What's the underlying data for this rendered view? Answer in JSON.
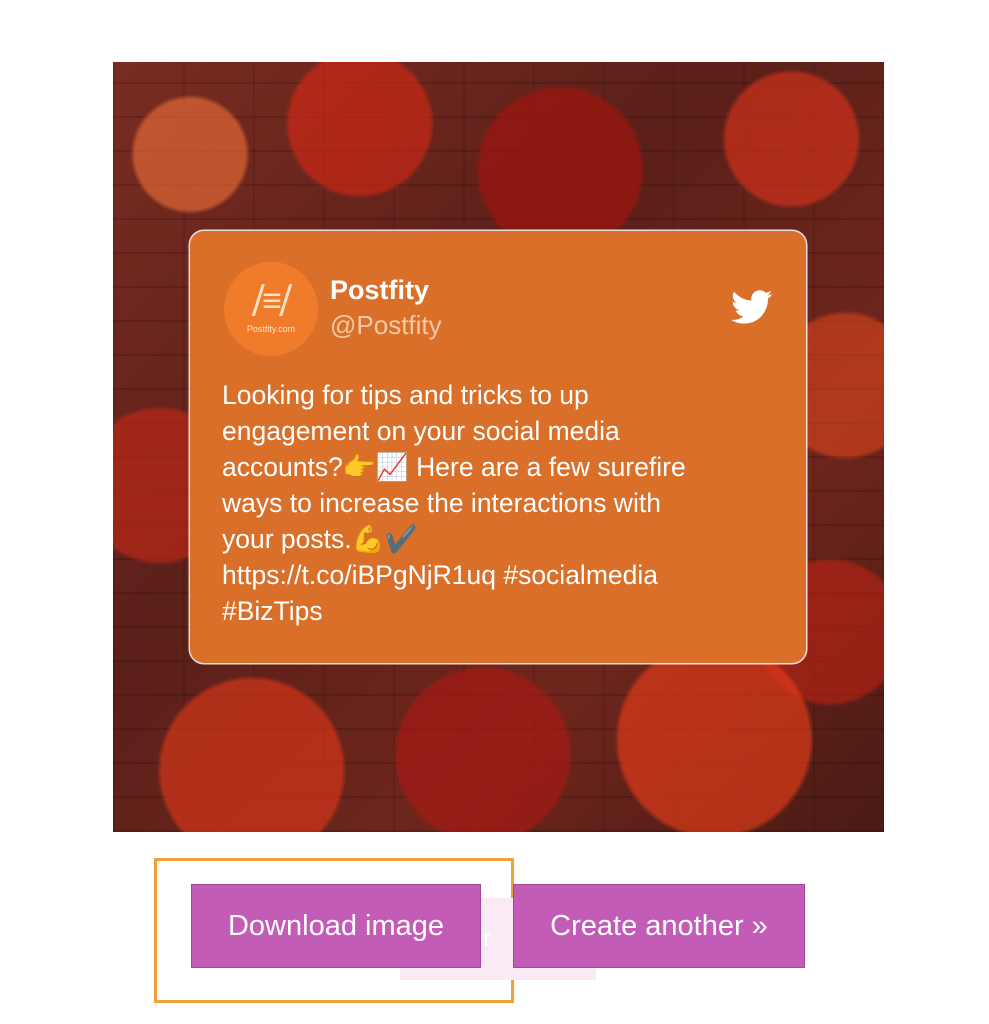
{
  "tweet_card": {
    "avatar_text": "Postfity.com",
    "name": "Postfity",
    "handle": "@Postfity",
    "text": "Looking for tips and tricks to up\nengagement on your social media\naccounts?👉📈 Here are a few surefire\nways to increase the interactions with\nyour posts.💪✔️\nhttps://t.co/iBPgNjR1uq #socialmedia\n#BizTips",
    "card_color": "#d96f28",
    "icon": "twitter-bird-icon"
  },
  "actions": {
    "download_label": "Download image",
    "create_label": "Create another »",
    "ghost_text": "er",
    "button_color": "#c25cb6",
    "highlight_color": "#f0a23a"
  }
}
